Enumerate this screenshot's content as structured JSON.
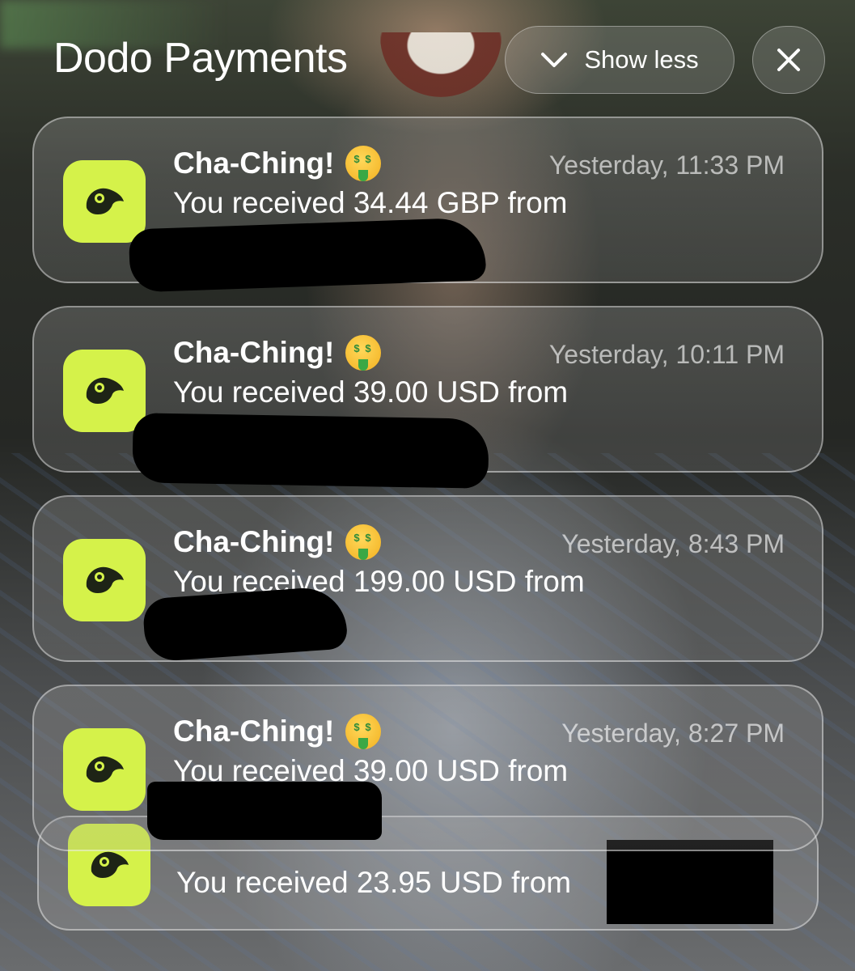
{
  "header": {
    "title": "Dodo Payments",
    "show_less_label": "Show less"
  },
  "notifications": [
    {
      "title": "Cha-Ching!",
      "time": "Yesterday, 11:33 PM",
      "body": "You received 34.44 GBP from"
    },
    {
      "title": "Cha-Ching!",
      "time": "Yesterday, 10:11 PM",
      "body": "You received 39.00 USD from"
    },
    {
      "title": "Cha-Ching!",
      "time": "Yesterday, 8:43 PM",
      "body": "You received 199.00 USD from"
    },
    {
      "title": "Cha-Ching!",
      "time": "Yesterday, 8:27 PM",
      "body": "You received 39.00 USD from"
    },
    {
      "title": "",
      "time": "",
      "body": "You received 23.95 USD from"
    }
  ],
  "icons": {
    "app": "dodo-bird-icon",
    "emoji": "money-mouth-face-icon",
    "chevron": "chevron-down-icon",
    "close": "close-icon"
  },
  "colors": {
    "app_icon_bg": "#d5f24a",
    "text_primary": "#ffffff"
  }
}
